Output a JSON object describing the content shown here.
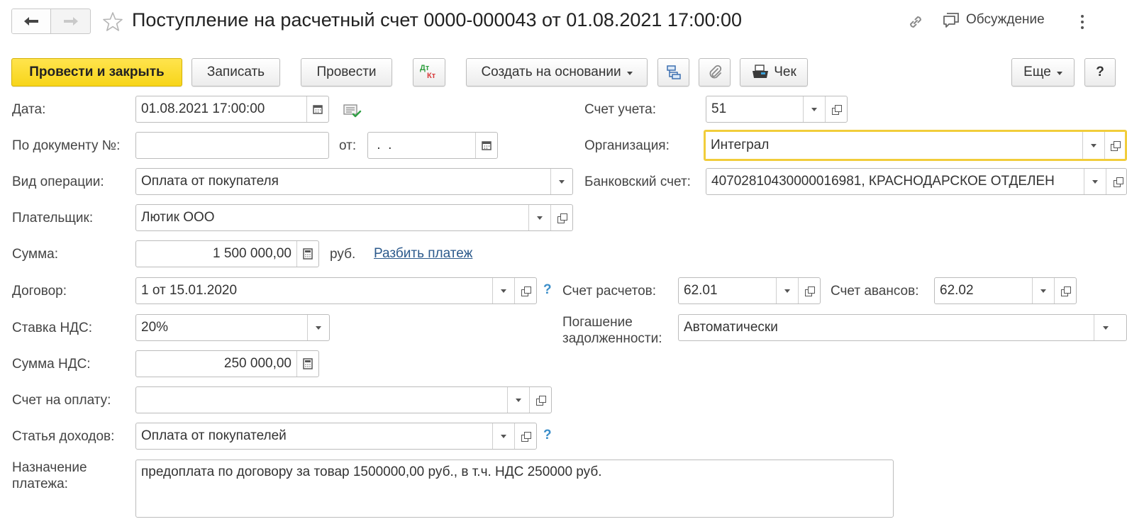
{
  "header": {
    "title": "Поступление на расчетный счет 0000-000043 от 01.08.2021 17:00:00",
    "discussion_label": "Обсуждение"
  },
  "toolbar": {
    "post_close_label": "Провести и закрыть",
    "save_label": "Записать",
    "post_label": "Провести",
    "dt_label": "Дт",
    "kt_label": "Кт",
    "create_based_label": "Создать на основании",
    "receipt_label": "Чек",
    "more_label": "Еще",
    "help_label": "?"
  },
  "form": {
    "date": {
      "label": "Дата:",
      "value": "01.08.2021 17:00:00"
    },
    "doc_number": {
      "label": "По документу №:",
      "value": "",
      "from_label": "от:",
      "from_value": " .  . "
    },
    "operation_type": {
      "label": "Вид операции:",
      "value": "Оплата от покупателя"
    },
    "payer": {
      "label": "Плательщик:",
      "value": "Лютик ООО"
    },
    "amount": {
      "label": "Сумма:",
      "value": "1 500 000,00",
      "currency": "руб.",
      "split_link": "Разбить платеж"
    },
    "contract": {
      "label": "Договор:",
      "value": "1 от 15.01.2020"
    },
    "vat_rate": {
      "label": "Ставка НДС:",
      "value": "20%"
    },
    "vat_amount": {
      "label": "Сумма НДС:",
      "value": "250 000,00"
    },
    "invoice": {
      "label": "Счет на оплату:",
      "value": ""
    },
    "income_item": {
      "label": "Статья доходов:",
      "value": "Оплата от покупателей"
    },
    "purpose": {
      "label_line1": "Назначение",
      "label_line2": "платежа:",
      "value": "предоплата по договору за товар 1500000,00 руб., в т.ч. НДС 250000 руб."
    },
    "account": {
      "label": "Счет учета:",
      "value": "51"
    },
    "organization": {
      "label": "Организация:",
      "value": "Интеграл"
    },
    "bank_account": {
      "label": "Банковский счет:",
      "value": "40702810430000016981, КРАСНОДАРСКОЕ ОТДЕЛЕН"
    },
    "settlement_account": {
      "label": "Счет расчетов:",
      "value": "62.01"
    },
    "advance_account": {
      "label": "Счет авансов:",
      "value": "62.02"
    },
    "debt_repayment": {
      "label_line1": "Погашение",
      "label_line2": "задолженности:",
      "value": "Автоматически"
    },
    "help_mark": "?"
  },
  "colors": {
    "primary_button": "#f7d51a",
    "focus_border": "#f1cd3b",
    "link": "#2c5a8c",
    "help_mark": "#3b8ec9"
  },
  "icons": [
    "back-arrow-icon",
    "forward-arrow-icon",
    "star-icon",
    "link-icon",
    "discussion-icon",
    "kebab-icon",
    "dt-kt-icon",
    "structure-icon",
    "paperclip-icon",
    "receipt-icon",
    "calendar-icon",
    "calculator-icon",
    "dropdown-arrow-icon",
    "open-icon",
    "message-check-icon"
  ]
}
